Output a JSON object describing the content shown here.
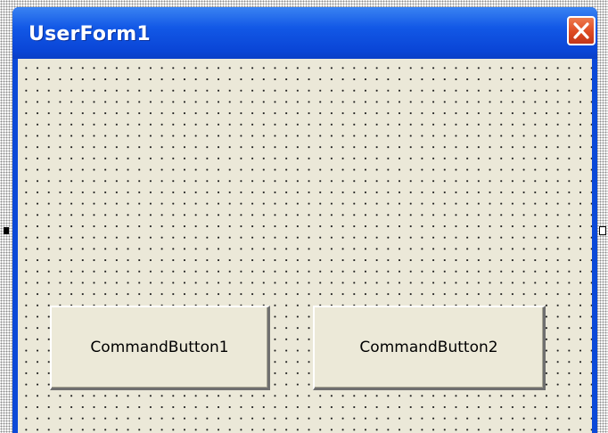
{
  "form": {
    "title": "UserForm1"
  },
  "buttons": [
    {
      "label": "CommandButton1"
    },
    {
      "label": "CommandButton2"
    }
  ],
  "icons": {
    "close": "close-icon"
  },
  "colors": {
    "titlebar": "#0a45d6",
    "client_background": "#ebe8d8",
    "close_button": "#dd4a22",
    "title_text": "#ffffff"
  }
}
